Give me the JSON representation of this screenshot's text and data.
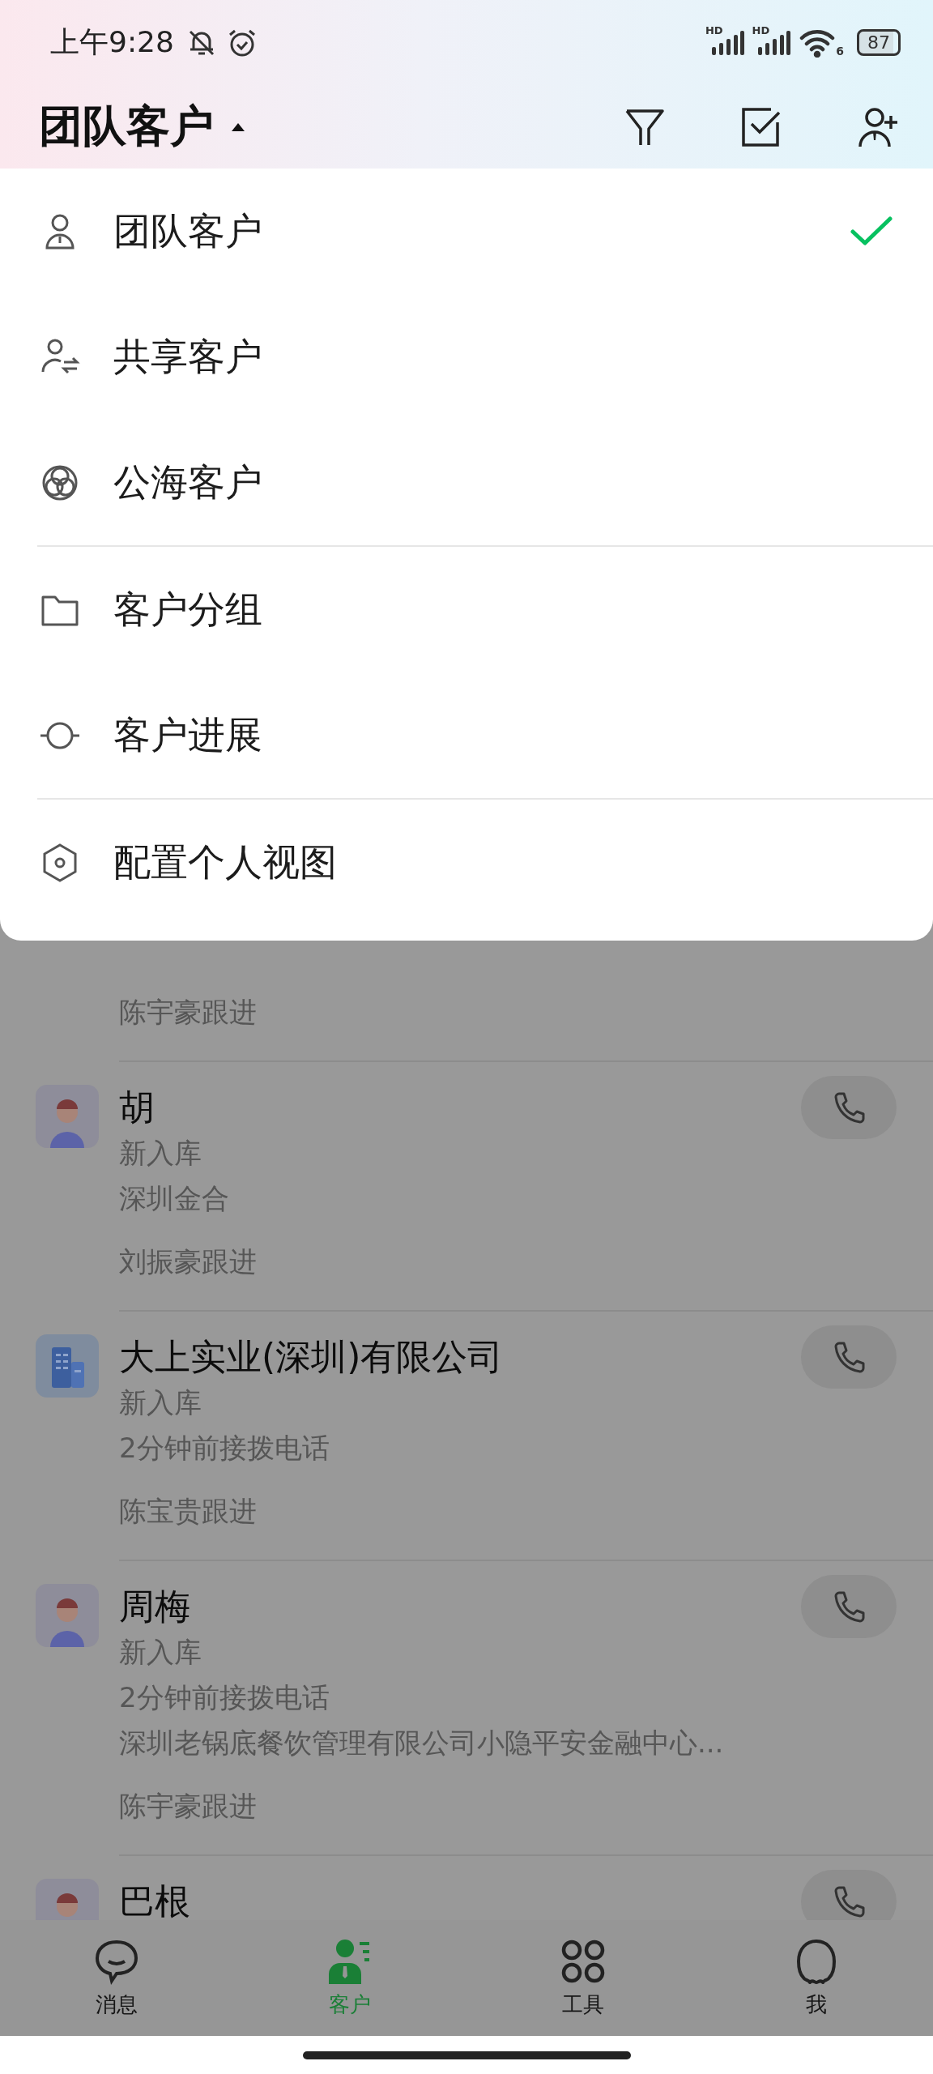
{
  "status_bar": {
    "time": "上午9:28",
    "signals": [
      {
        "label": "HD"
      },
      {
        "label": "HD"
      }
    ],
    "wifi_label": "6",
    "battery": "87"
  },
  "header": {
    "title": "团队客户",
    "expanded": true
  },
  "dropdown": {
    "sections": [
      {
        "items": [
          {
            "label": "团队客户",
            "selected": true
          },
          {
            "label": "共享客户",
            "selected": false
          },
          {
            "label": "公海客户",
            "selected": false
          }
        ]
      },
      {
        "items": [
          {
            "label": "客户分组",
            "selected": false
          },
          {
            "label": "客户进展",
            "selected": false
          }
        ]
      },
      {
        "items": [
          {
            "label": "配置个人视图",
            "selected": false
          }
        ]
      }
    ]
  },
  "customers": [
    {
      "follower": "陈宇豪跟进"
    },
    {
      "kind": "person",
      "name": "胡",
      "status": "新入库",
      "details": [
        "深圳金合"
      ],
      "follower": "刘振豪跟进"
    },
    {
      "kind": "company",
      "name": "大上实业(深圳)有限公司",
      "status": "新入库",
      "details": [
        "2分钟前接拨电话"
      ],
      "follower": "陈宝贵跟进"
    },
    {
      "kind": "person",
      "name": "周梅",
      "status": "新入库",
      "details": [
        "2分钟前接拨电话",
        "深圳老锅底餐饮管理有限公司小隐平安金融中心..."
      ],
      "follower": "陈宇豪跟进"
    },
    {
      "kind": "person",
      "name": "巴根"
    }
  ],
  "tab_bar": [
    {
      "label": "消息",
      "selected": false
    },
    {
      "label": "客户",
      "selected": true
    },
    {
      "label": "工具",
      "selected": false
    },
    {
      "label": "我",
      "selected": false
    }
  ]
}
